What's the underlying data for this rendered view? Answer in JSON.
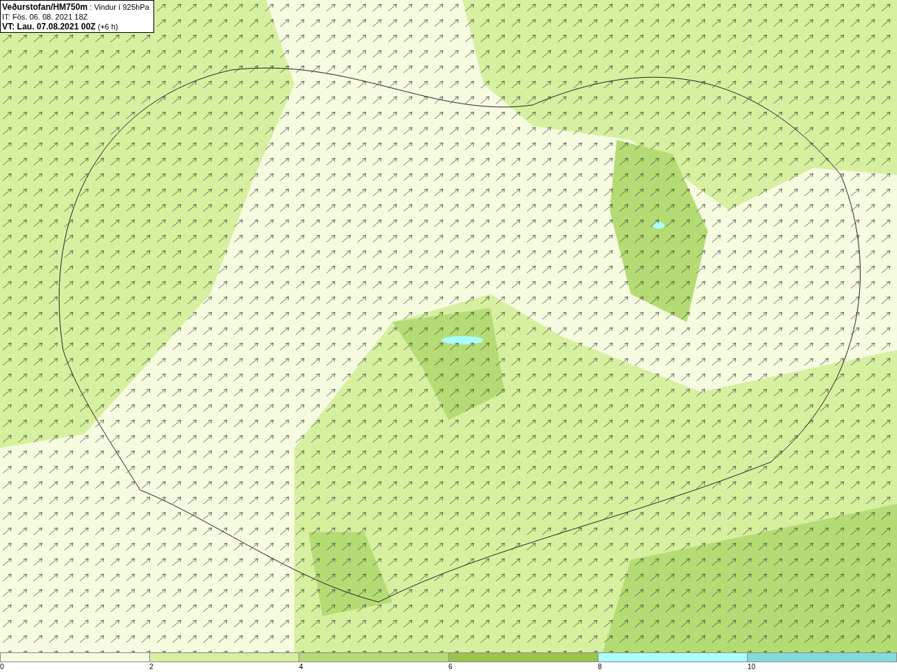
{
  "title_box": {
    "lines": [
      "**Veðurstofan/HM750m** : Vindur í 925hPa",
      "IT: Fös. 06. 08. 2021 18Z",
      "**VT: Lau. 07.08.2021 00Z** (+6 h)"
    ]
  },
  "legend": [
    {
      "label": "0",
      "color": "#f5fce0"
    },
    {
      "label": "2",
      "color": "#d6f0a0"
    },
    {
      "label": "4",
      "color": "#b5dc74"
    },
    {
      "label": "6",
      "color": "#9cc44c"
    },
    {
      "label": "8",
      "color": "#aaffff"
    },
    {
      "label": "10",
      "color": "#80dcdc"
    }
  ]
}
